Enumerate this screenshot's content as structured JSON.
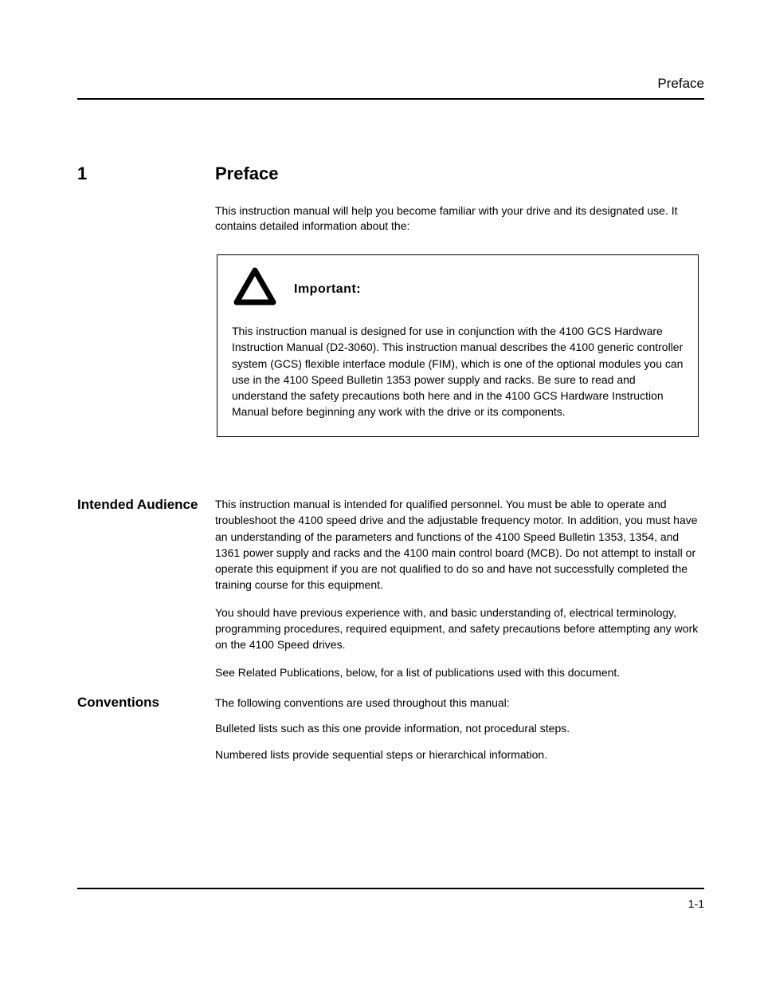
{
  "header": {
    "title": "Preface"
  },
  "chapter": {
    "num": "1",
    "title": "Preface"
  },
  "intro": "This instruction manual will help you become familiar with your drive and its designated use. It contains detailed information about the:",
  "important": {
    "label": "Important:",
    "text": "This instruction manual is designed for use in conjunction with the 4100 GCS Hardware Instruction Manual (D2-3060). This instruction manual describes the 4100 generic controller system (GCS) flexible interface module (FIM), which is one of the optional modules you can use in the 4100 Speed Bulletin 1353 power supply and racks. Be sure to read and understand the safety precautions both here and in the 4100 GCS Hardware Instruction Manual before beginning any work with the drive or its components."
  },
  "intended_heading": "Intended Audience",
  "intended_paras": [
    "This instruction manual is intended for qualified personnel. You must be able to operate and troubleshoot the 4100 speed drive and the adjustable frequency motor. In addition, you must have an understanding of the parameters and functions of the 4100 Speed Bulletin 1353, 1354, and 1361 power supply and racks and the 4100 main control board (MCB). Do not attempt to install or operate this equipment if you are not qualified to do so and have not successfully completed the training course for this equipment.",
    "You should have previous experience with, and basic understanding of, electrical terminology, programming procedures, required equipment, and safety precautions before attempting any work on the 4100 Speed drives.",
    "See Related Publications, below, for a list of publications used with this document."
  ],
  "conventions_heading": "Conventions",
  "conventions_paras": [
    "The following conventions are used throughout this manual:",
    "Bulleted lists such as this one provide information, not procedural steps.",
    "Numbered lists provide sequential steps or hierarchical information."
  ],
  "footer": {
    "page": "1-1"
  }
}
